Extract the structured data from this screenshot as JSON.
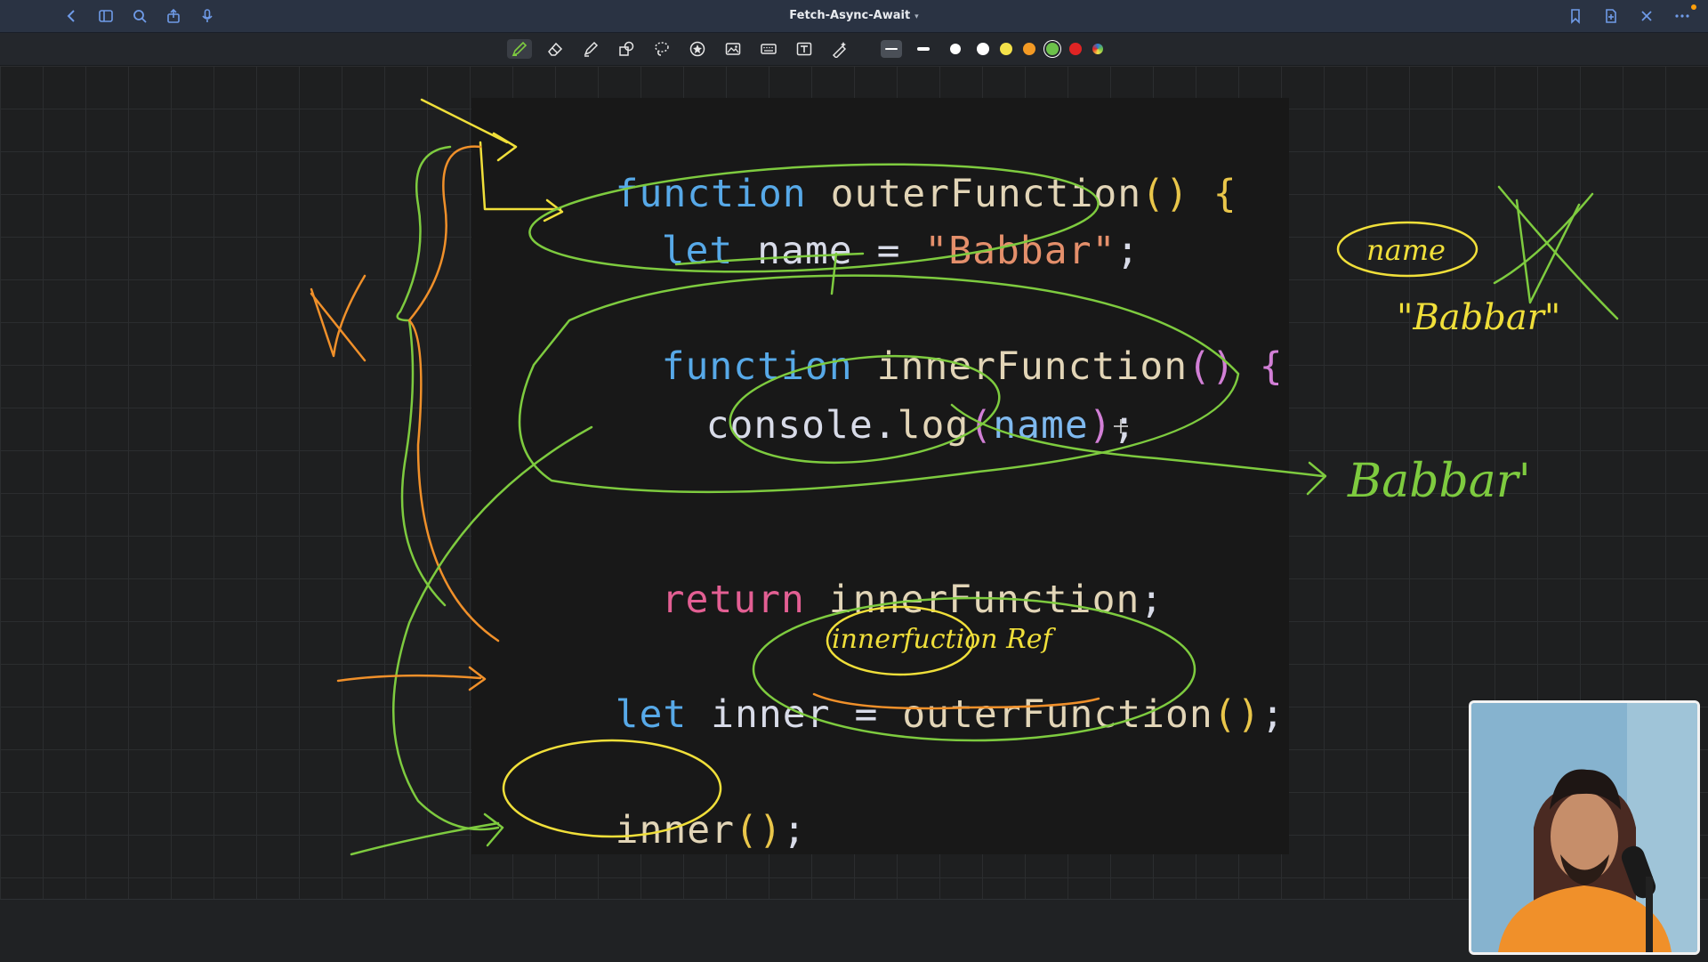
{
  "titlebar": {
    "doc_title": "Fetch-Async-Await",
    "left_icons": [
      "back-chevron-icon",
      "sidebar-icon",
      "search-icon",
      "share-icon",
      "microphone-icon"
    ],
    "right_icons": [
      "bookmark-icon",
      "add-page-icon",
      "close-icon",
      "more-icon"
    ]
  },
  "toolbar": {
    "tools": [
      "pen-icon",
      "eraser-icon",
      "highlighter-icon",
      "shapes-icon",
      "lasso-icon",
      "sticker-icon",
      "image-icon",
      "keyboard-icon",
      "text-box-icon",
      "magic-pen-icon"
    ],
    "selected_tool": "pen-icon",
    "stroke_widths": [
      "thin",
      "medium",
      "thick"
    ],
    "selected_stroke": "thin",
    "colors": [
      "#ffffff",
      "#f4e24a",
      "#f39a24",
      "#6cc24a",
      "#e02424",
      "#2a7bd6"
    ],
    "selected_color": "#6cc24a"
  },
  "code": {
    "line1": {
      "kw": "function",
      "name": "outerFunction",
      "paren": "()",
      "brace": "{"
    },
    "line2": {
      "kw": "let",
      "var": "name",
      "op": "=",
      "str": "\"Babbar\"",
      "end": ";"
    },
    "line3": {
      "kw": "function",
      "name": "innerFunction",
      "paren": "()",
      "brace": "{"
    },
    "line4": {
      "obj": "console",
      "dot": ".",
      "method": "log",
      "open": "(",
      "arg": "name",
      "close": ")",
      "end": ";"
    },
    "line5": {
      "kw": "return",
      "name": "innerFunction",
      "end": ";"
    },
    "line6": {
      "kw": "let",
      "var": "inner",
      "op": "=",
      "call": "outerFunction",
      "paren": "()",
      "end": ";"
    },
    "line7": {
      "call": "inner",
      "paren": "()",
      "end": ";"
    }
  },
  "annotations": {
    "closure_label": "name",
    "closure_value": "\"Babbar\"",
    "output": "Babbar'",
    "ref_label": "innerfuction Ref"
  },
  "ink_colors": {
    "green": "#7ecb3f",
    "yellow": "#f0df3a",
    "orange": "#f0902a"
  }
}
